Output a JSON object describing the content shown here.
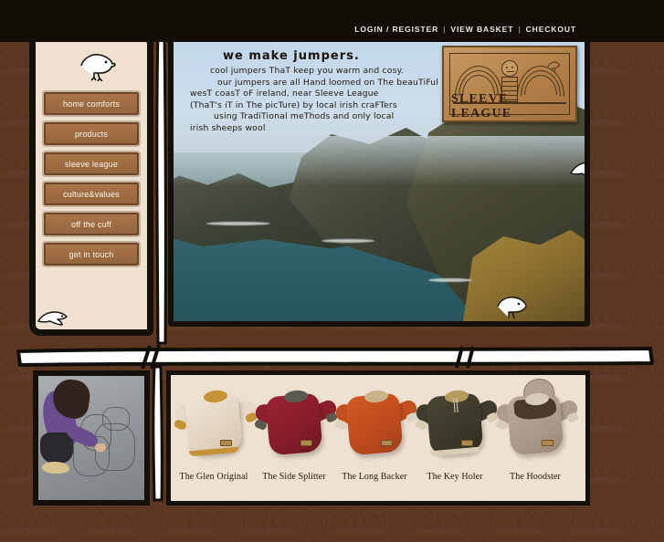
{
  "site": {
    "brand": "SLEEVE LEAGUE",
    "background_color": "#5b3620",
    "panel_color": "#efe0cf",
    "ink_color": "#14100c",
    "button_color": "#a9754a"
  },
  "topnav": {
    "login_register": "LOGIN / REGISTER",
    "view_basket": "VIEW BASKET",
    "checkout": "CHECKOUT",
    "separator": "|"
  },
  "sidebar": {
    "bird_icon": "bird-icon",
    "items": [
      {
        "label": "home comforts"
      },
      {
        "label": "products"
      },
      {
        "label": "sleeve league"
      },
      {
        "label": "culture&values"
      },
      {
        "label": "off the cuff"
      },
      {
        "label": "get in touch"
      }
    ]
  },
  "hero": {
    "headline": "we make jumpers.",
    "lines": [
      "cool jumpers ThaT keep you warm and cosy.",
      "our jumpers are all Hand loomed on The beauTiFul",
      "wesT coasT oF ireland, near Sleeve League",
      "(ThaT's iT in The picTure) by local irish craFTers",
      "using TradiTional meThods and only local",
      "irish sheeps wool"
    ],
    "logo_label": "SLEEVE LEAGUE",
    "bird_icon": "bird-icon",
    "flying_bird_icon": "flying-bird-icon"
  },
  "products": {
    "items": [
      {
        "label": "The Glen Original",
        "body": "#e6d9c8",
        "collar": "#c59237",
        "cuff": "#c59237",
        "hem": "#c59237"
      },
      {
        "label": "The Side Splitter",
        "body": "#8e1f2c",
        "collar": "#5b5a4e",
        "cuff": "#5b5a4e",
        "hem": "#8e1f2c"
      },
      {
        "label": "The Long Backer",
        "body": "#c4501f",
        "collar": "#c9b489",
        "cuff": "#ddd2bd",
        "hem": "#c4501f"
      },
      {
        "label": "The Key Holer",
        "body": "#3f3b2c",
        "collar": "#b59a5e",
        "cuff": "#d9cdb6",
        "hem": "#d9cdb6"
      },
      {
        "label": "The Hoodster",
        "body": "#b09c8c",
        "collar": "#d6cbbd",
        "cuff": "#d6cbbd",
        "hem": "#b09c8c",
        "yoke": "#4a3a2e"
      }
    ]
  },
  "photo_panel": {
    "alt_name": "craftsperson-drawing-photo"
  }
}
